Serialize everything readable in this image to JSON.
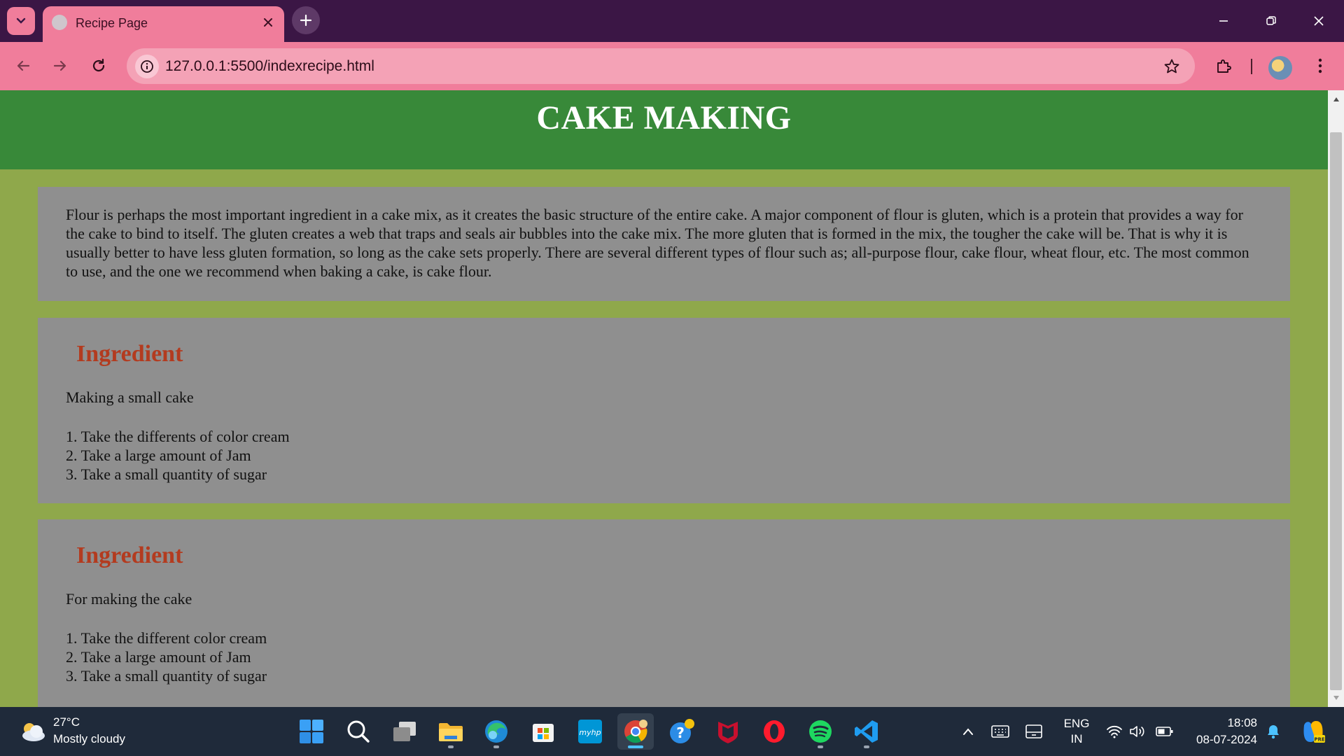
{
  "browser": {
    "tab_title": "Recipe Page",
    "url": "127.0.0.1:5500/indexrecipe.html"
  },
  "page": {
    "header_title": "CAKE MAKING",
    "intro_text": "Flour is perhaps the most important ingredient in a cake mix, as it creates the basic structure of the entire cake. A major component of flour is gluten, which is a protein that provides a way for the cake to bind to itself. The gluten creates a web that traps and seals air bubbles into the cake mix. The more gluten that is formed in the mix, the tougher the cake will be. That is why it is usually better to have less gluten formation, so long as the cake sets properly. There are several different types of flour such as; all-purpose flour, cake flour, wheat flour, etc. The most common to use, and the one we recommend when baking a cake, is cake flour.",
    "sections": [
      {
        "heading": "Ingredient",
        "subtitle": "Making a small cake",
        "steps": [
          "1. Take the differents of color cream",
          "2. Take a large amount of Jam",
          "3. Take a small quantity of sugar"
        ]
      },
      {
        "heading": "Ingredient",
        "subtitle": "For making the cake",
        "steps": [
          "1. Take the different color cream",
          "2. Take a large amount of Jam",
          "3. Take a small quantity of sugar"
        ]
      }
    ],
    "colors": {
      "header_bg": "#388939",
      "page_bg": "#8fa84b",
      "card_bg": "#8f8f8f",
      "heading_color": "#b33b1f"
    }
  },
  "taskbar": {
    "weather_temp": "27°C",
    "weather_desc": "Mostly cloudy",
    "lang_line1": "ENG",
    "lang_line2": "IN",
    "time": "18:08",
    "date": "08-07-2024",
    "apps": [
      "start-icon",
      "search-icon",
      "task-view-icon",
      "file-explorer-icon",
      "edge-icon",
      "microsoft-store-icon",
      "myhp-icon",
      "chrome-icon",
      "get-help-icon",
      "mcafee-icon",
      "opera-icon",
      "spotify-icon",
      "vscode-icon"
    ]
  }
}
